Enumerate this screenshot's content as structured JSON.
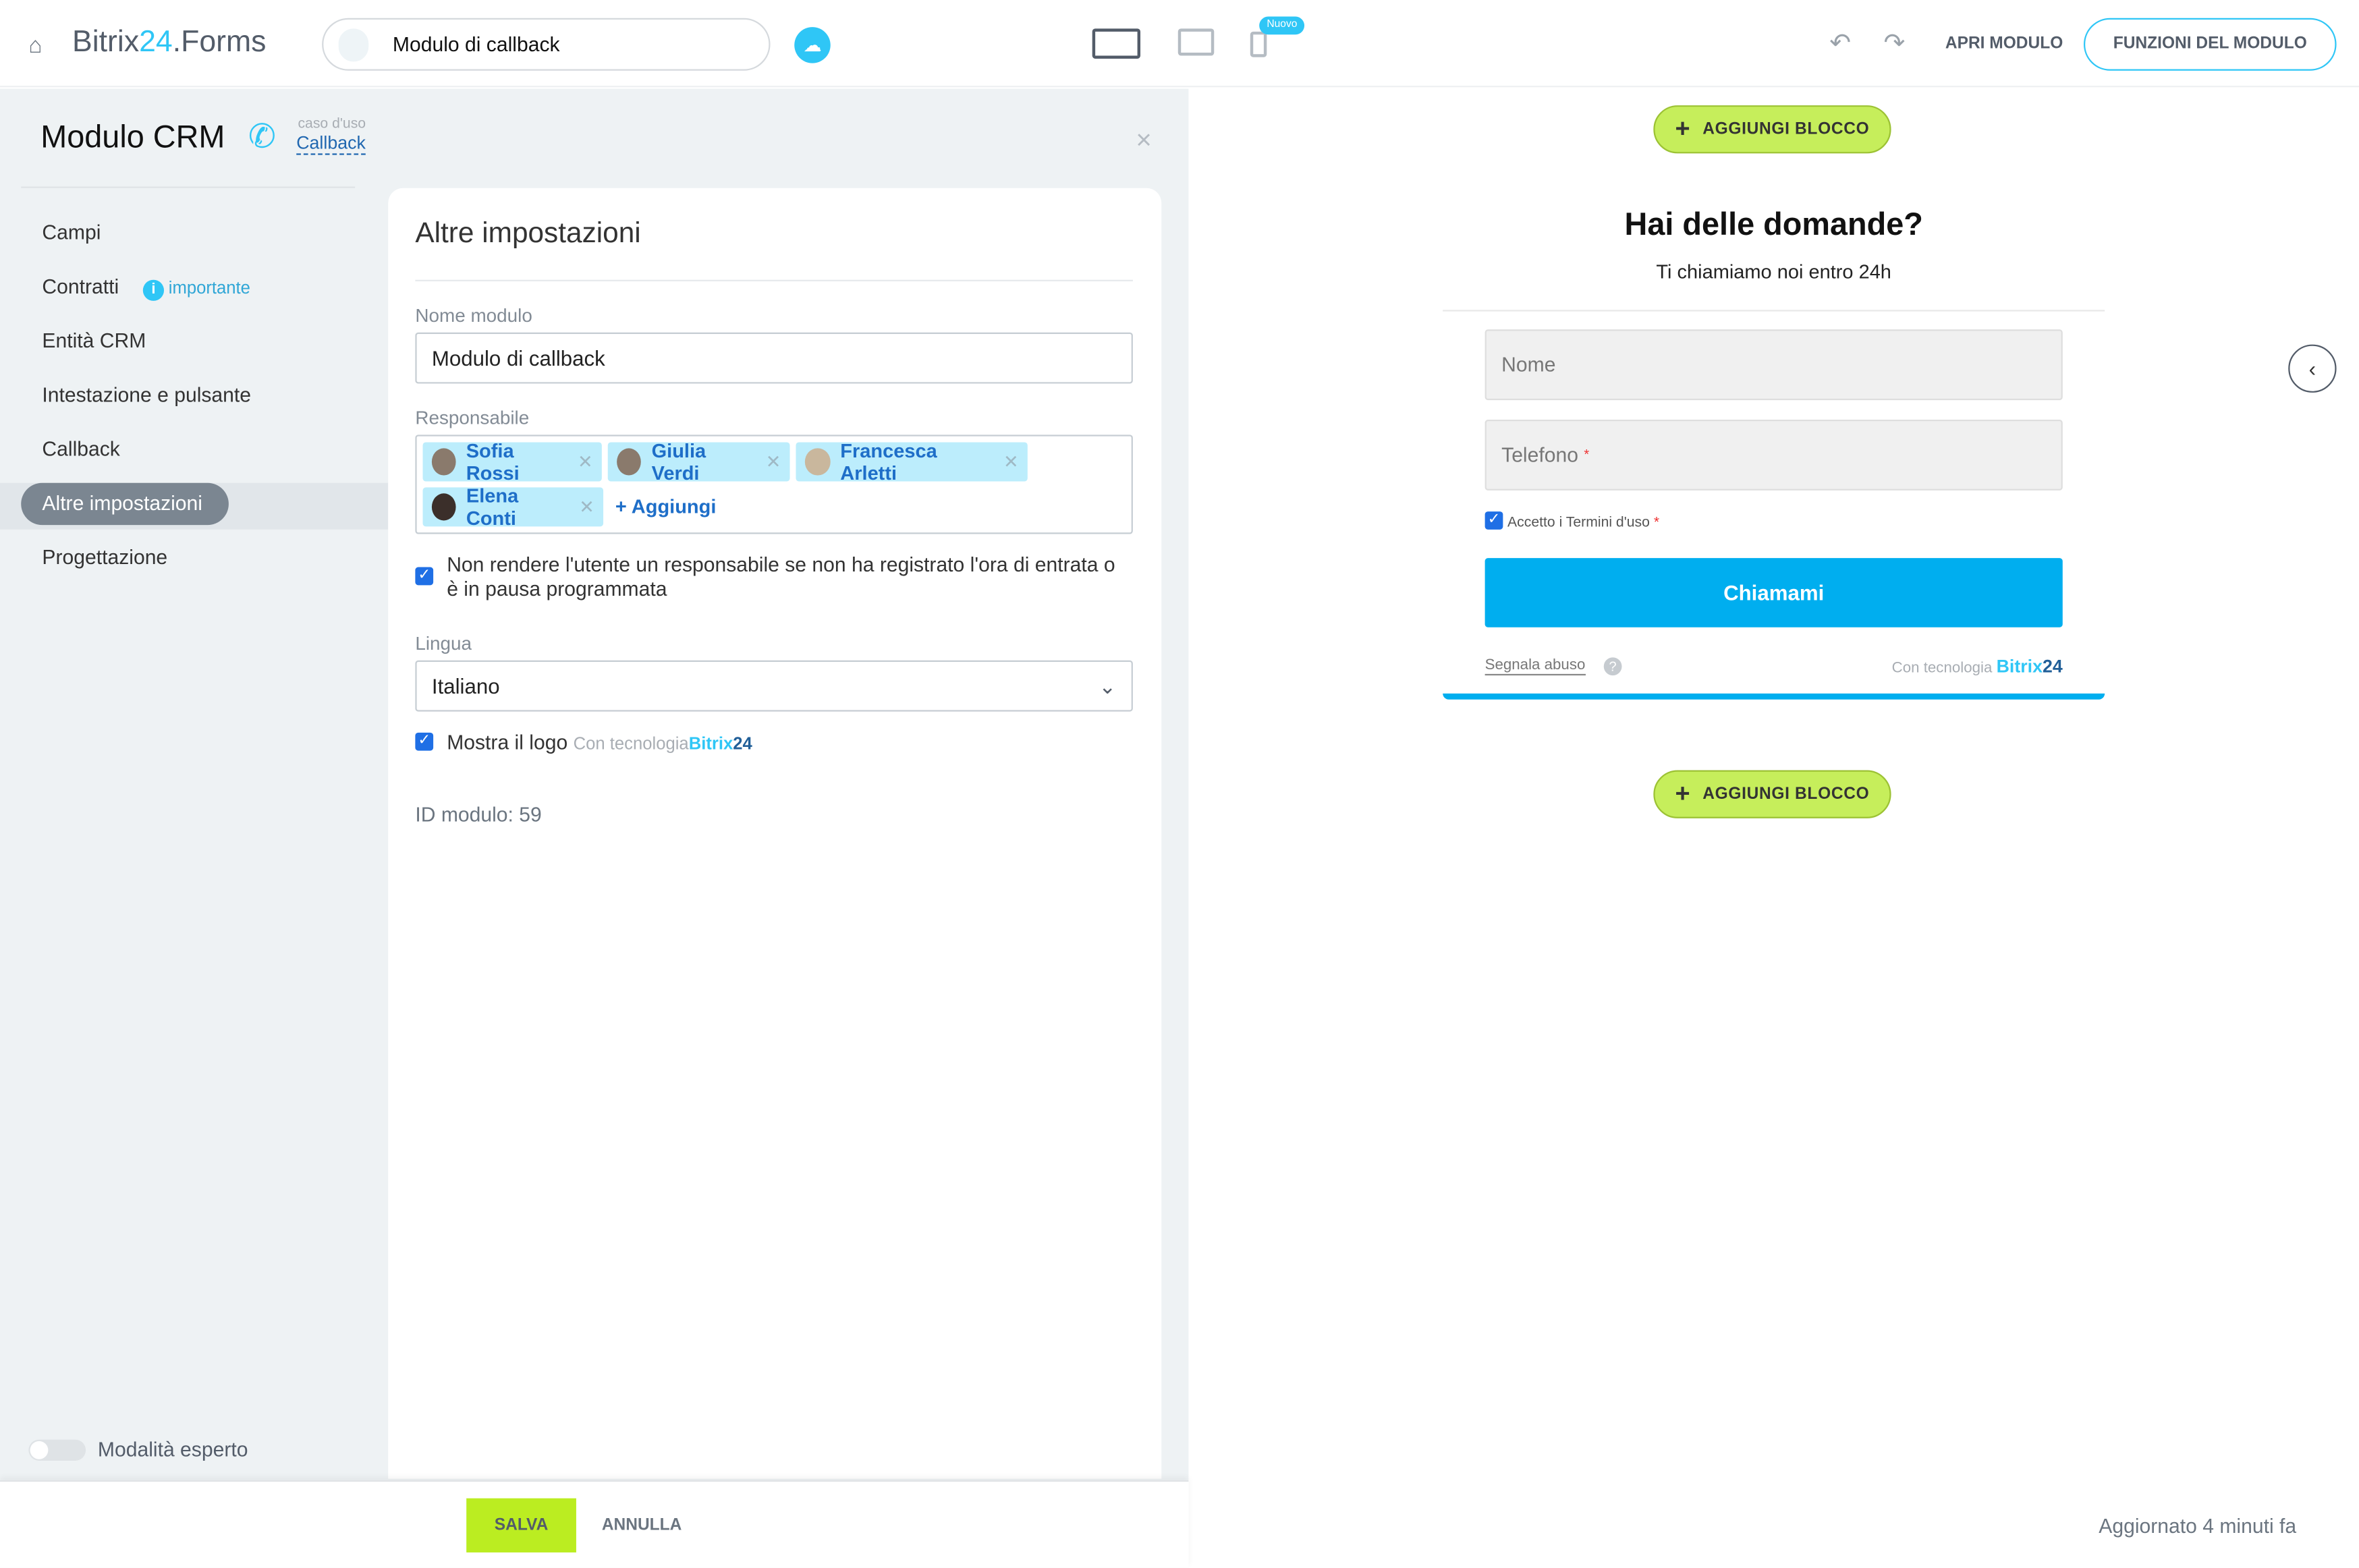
{
  "header": {
    "brand_main": "Bitrix",
    "brand_num": "24",
    "brand_suffix": ".Forms",
    "form_name": "Modulo di callback",
    "new_badge": "Nuovo",
    "open_form": "APRI MODULO",
    "form_functions": "FUNZIONI DEL MODULO"
  },
  "sidebar": {
    "title": "Modulo CRM",
    "use_case_label": "caso d'uso",
    "use_case_value": "Callback",
    "items": [
      {
        "label": "Campi"
      },
      {
        "label": "Contratti",
        "badge": "importante"
      },
      {
        "label": "Entità CRM"
      },
      {
        "label": "Intestazione e pulsante"
      },
      {
        "label": "Callback"
      },
      {
        "label": "Altre impostazioni",
        "active": true
      },
      {
        "label": "Progettazione"
      }
    ],
    "expert_mode": "Modalità esperto",
    "expert_mode_on": false
  },
  "settings": {
    "title": "Altre impostazioni",
    "name_label": "Nome modulo",
    "name_value": "Modulo di callback",
    "responsible_label": "Responsabile",
    "responsibles": [
      "Sofia Rossi",
      "Giulia Verdi",
      "Francesca Arletti",
      "Elena Conti"
    ],
    "add_label": "+ Aggiungi",
    "checkbox1": "Non rendere l'utente un responsabile se non ha registrato l'ora di entrata o è in pausa programmata",
    "checkbox1_checked": true,
    "language_label": "Lingua",
    "language_value": "Italiano",
    "checkbox2": "Mostra il logo",
    "checkbox2_checked": true,
    "powered": "Con tecnologia",
    "powered_brand": "Bitrix",
    "powered_num": "24",
    "form_id": "ID modulo: 59"
  },
  "footer": {
    "save": "SALVA",
    "cancel": "ANNULLA",
    "updated": "Aggiornato 4 minuti fa"
  },
  "preview": {
    "add_block": "AGGIUNGI BLOCCO",
    "title": "Hai delle domande?",
    "subtitle": "Ti chiamiamo noi entro 24h",
    "name_placeholder": "Nome",
    "phone_placeholder": "Telefono",
    "required_mark": "*",
    "terms": "Accetto i Termini d'uso",
    "submit": "Chiamami",
    "report": "Segnala abuso",
    "powered": "Con tecnologia",
    "brand": "Bitrix",
    "brand_num": "24"
  },
  "colors": {
    "accent": "#00aeef",
    "brand_blue": "#2fc6f6",
    "green": "#c6ee5b",
    "tag_bg": "#bcedfc"
  }
}
